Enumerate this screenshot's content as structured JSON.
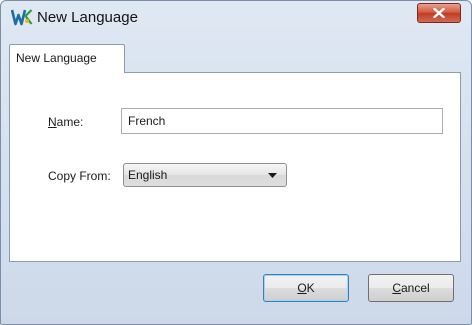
{
  "window": {
    "title": "New Language",
    "app_icon": "app-w-icon",
    "close_icon": "close-icon"
  },
  "tabs": [
    {
      "label": "New Language",
      "selected": true
    }
  ],
  "form": {
    "name_label_underlined": "N",
    "name_label_rest": "ame:",
    "name_value": "French",
    "copy_from_label": "Copy From:",
    "copy_from_value": "English",
    "dropdown_icon": "chevron-down-icon"
  },
  "buttons": {
    "ok_underlined": "O",
    "ok_rest": "K",
    "cancel_underlined": "C",
    "cancel_rest": "ancel"
  },
  "colors": {
    "window_frame": "#d3dfee",
    "close_button": "#c8432b",
    "default_button_border": "#3c7fb1"
  }
}
